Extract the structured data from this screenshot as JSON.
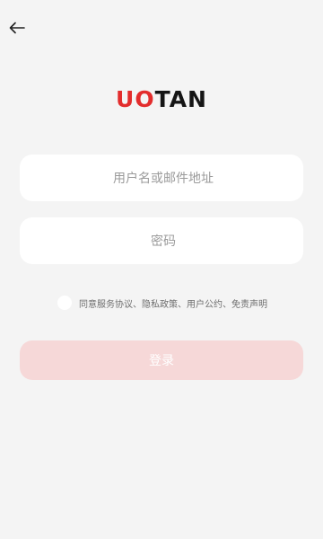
{
  "header": {
    "back_icon": "arrow-left-icon"
  },
  "logo": {
    "part1": "UO",
    "part2": "TAN"
  },
  "form": {
    "username_placeholder": "用户名或邮件地址",
    "password_placeholder": "密码",
    "agreement_text": "同意服务协议、隐私政策、用户公约、免责声明",
    "login_label": "登录"
  },
  "colors": {
    "background": "#f4f4f4",
    "brand_red": "#e32d2d",
    "login_button": "#f6d8d8"
  }
}
